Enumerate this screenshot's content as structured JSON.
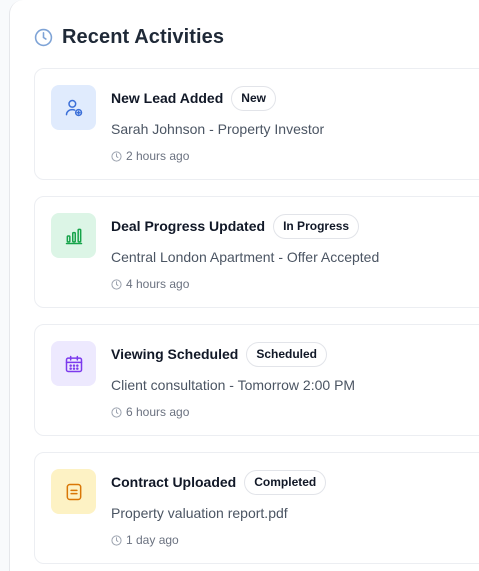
{
  "header": {
    "title": "Recent Activities",
    "icon": "clock-icon"
  },
  "activities": [
    {
      "title": "New Lead Added",
      "badge": "New",
      "description": "Sarah Johnson - Property Investor",
      "time": "2 hours ago",
      "icon": "user-add-icon",
      "icon_bg": "#e0ebfd",
      "icon_color": "#3b6fd8"
    },
    {
      "title": "Deal Progress Updated",
      "badge": "In Progress",
      "description": "Central London Apartment - Offer Accepted",
      "time": "4 hours ago",
      "icon": "bar-chart-icon",
      "icon_bg": "#dcf5e6",
      "icon_color": "#16a34a"
    },
    {
      "title": "Viewing Scheduled",
      "badge": "Scheduled",
      "description": "Client consultation - Tomorrow 2:00 PM",
      "time": "6 hours ago",
      "icon": "calendar-icon",
      "icon_bg": "#ede9fe",
      "icon_color": "#7c3aed"
    },
    {
      "title": "Contract Uploaded",
      "badge": "Completed",
      "description": "Property valuation report.pdf",
      "time": "1 day ago",
      "icon": "document-icon",
      "icon_bg": "#fdf2c4",
      "icon_color": "#d97706"
    }
  ]
}
